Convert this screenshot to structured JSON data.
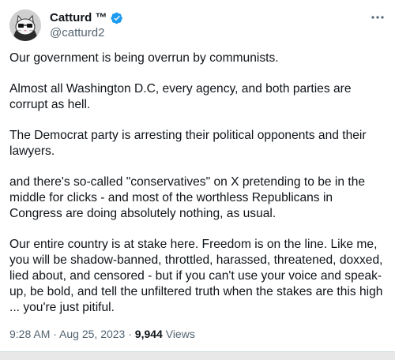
{
  "author": {
    "display_name": "Catturd ™",
    "handle": "@catturd2",
    "avatar_icon": "cat-avatar-icon",
    "verified_icon": "verified-badge-icon",
    "verified_color": "#1d9bf0"
  },
  "menu": {
    "icon": "more-options-icon"
  },
  "tweet": {
    "paragraphs": [
      "Our government is being overrun by communists.",
      "Almost all Washington D.C, every agency, and both parties are corrupt as hell.",
      "The Democrat party is arresting their political opponents and their lawyers.",
      "and there's so-called \"conservatives\" on X pretending to be in the middle for clicks - and most of the worthless Republicans in Congress are doing absolutely nothing, as usual.",
      "Our entire country is at stake here. Freedom is on the line. Like me, you will be shadow-banned, throttled, harassed, threatened, doxxed, lied about, and censored - but if you can't use your voice and speak-up, be bold, and tell the unfiltered truth when the stakes are this high  ... you're just pitiful."
    ]
  },
  "meta": {
    "time": "9:28 AM",
    "separator": " · ",
    "date": "Aug 25, 2023",
    "views_count": "9,944",
    "views_label": " Views"
  }
}
